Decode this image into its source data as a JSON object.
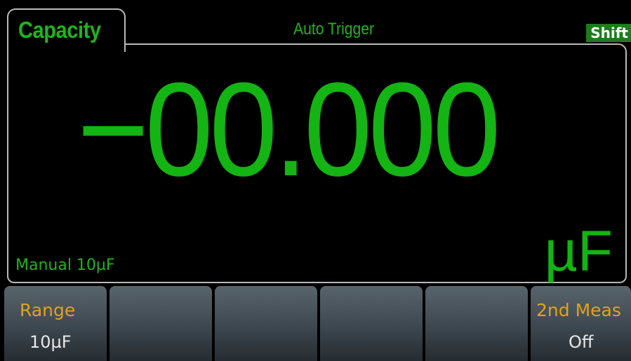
{
  "header": {
    "function_tab": "Capacity",
    "trigger_mode": "Auto Trigger",
    "shift_indicator": "Shift"
  },
  "display": {
    "reading": "−00.000",
    "unit": "µF",
    "range_status": "Manual 10µF"
  },
  "softkeys": [
    {
      "line1": "Range",
      "line2": "10µF"
    },
    {
      "line1": "",
      "line2": ""
    },
    {
      "line1": "",
      "line2": ""
    },
    {
      "line1": "",
      "line2": ""
    },
    {
      "line1": "",
      "line2": ""
    },
    {
      "line1": "2nd Meas",
      "line2": "Off"
    }
  ],
  "colors": {
    "reading_green": "#13b413",
    "label_green": "#1db51d",
    "softkey_label_amber": "#e2a21a"
  }
}
